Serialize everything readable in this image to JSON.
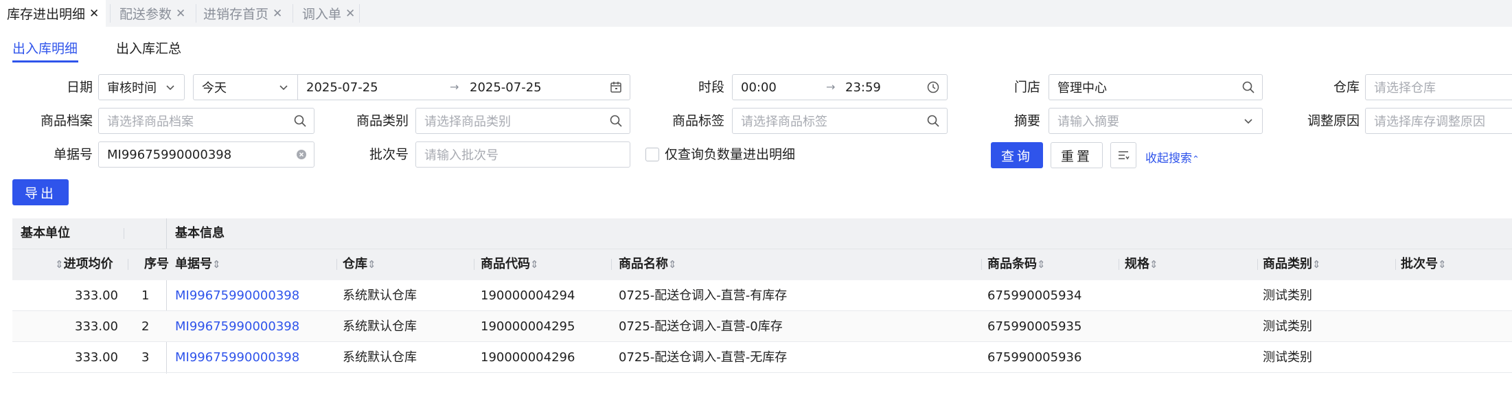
{
  "tabs": [
    {
      "label": "库存进出明细",
      "active": true
    },
    {
      "label": "配送参数",
      "active": false
    },
    {
      "label": "进销存首页",
      "active": false
    },
    {
      "label": "调入单",
      "active": false
    }
  ],
  "subtabs": {
    "detail": "出入库明细",
    "summary": "出入库汇总"
  },
  "form": {
    "date": {
      "label": "日期",
      "type_value": "审核时间",
      "range_value": "今天",
      "start": "2025-07-25",
      "end": "2025-07-25"
    },
    "period": {
      "label": "时段",
      "start": "00:00",
      "end": "23:59"
    },
    "store": {
      "label": "门店",
      "value": "管理中心"
    },
    "warehouse": {
      "label": "仓库",
      "placeholder": "请选择仓库"
    },
    "product_archive": {
      "label": "商品档案",
      "placeholder": "请选择商品档案"
    },
    "product_category": {
      "label": "商品类别",
      "placeholder": "请选择商品类别"
    },
    "product_tag": {
      "label": "商品标签",
      "placeholder": "请选择商品标签"
    },
    "summary": {
      "label": "摘要",
      "placeholder": "请输入摘要"
    },
    "adjust_reason": {
      "label": "调整原因",
      "placeholder": "请选择库存调整原因"
    },
    "doc_no": {
      "label": "单据号",
      "value": "MI99675990000398"
    },
    "batch_no": {
      "label": "批次号",
      "placeholder": "请输入批次号"
    },
    "negative_only": {
      "label": "仅查询负数量进出明细",
      "checked": false
    }
  },
  "buttons": {
    "query": "查询",
    "reset": "重置",
    "collapse": "收起搜索",
    "export": "导出"
  },
  "table": {
    "group_headers": {
      "unit": "基本单位",
      "info": "基本信息"
    },
    "columns": {
      "avg_price": "进项均价",
      "seq": "序号",
      "doc_no": "单据号",
      "warehouse": "仓库",
      "code": "商品代码",
      "name": "商品名称",
      "barcode": "商品条码",
      "spec": "规格",
      "category": "商品类别",
      "batch": "批次号"
    },
    "rows": [
      {
        "avg_price": "333.00",
        "seq": "1",
        "doc_no": "MI99675990000398",
        "warehouse": "系统默认仓库",
        "code": "190000004294",
        "name": "0725-配送仓调入-直营-有库存",
        "barcode": "675990005934",
        "spec": "",
        "category": "测试类别",
        "batch": ""
      },
      {
        "avg_price": "333.00",
        "seq": "2",
        "doc_no": "MI99675990000398",
        "warehouse": "系统默认仓库",
        "code": "190000004295",
        "name": "0725-配送仓调入-直营-0库存",
        "barcode": "675990005935",
        "spec": "",
        "category": "测试类别",
        "batch": ""
      },
      {
        "avg_price": "333.00",
        "seq": "3",
        "doc_no": "MI99675990000398",
        "warehouse": "系统默认仓库",
        "code": "190000004296",
        "name": "0725-配送仓调入-直营-无库存",
        "barcode": "675990005936",
        "spec": "",
        "category": "测试类别",
        "batch": ""
      }
    ]
  }
}
